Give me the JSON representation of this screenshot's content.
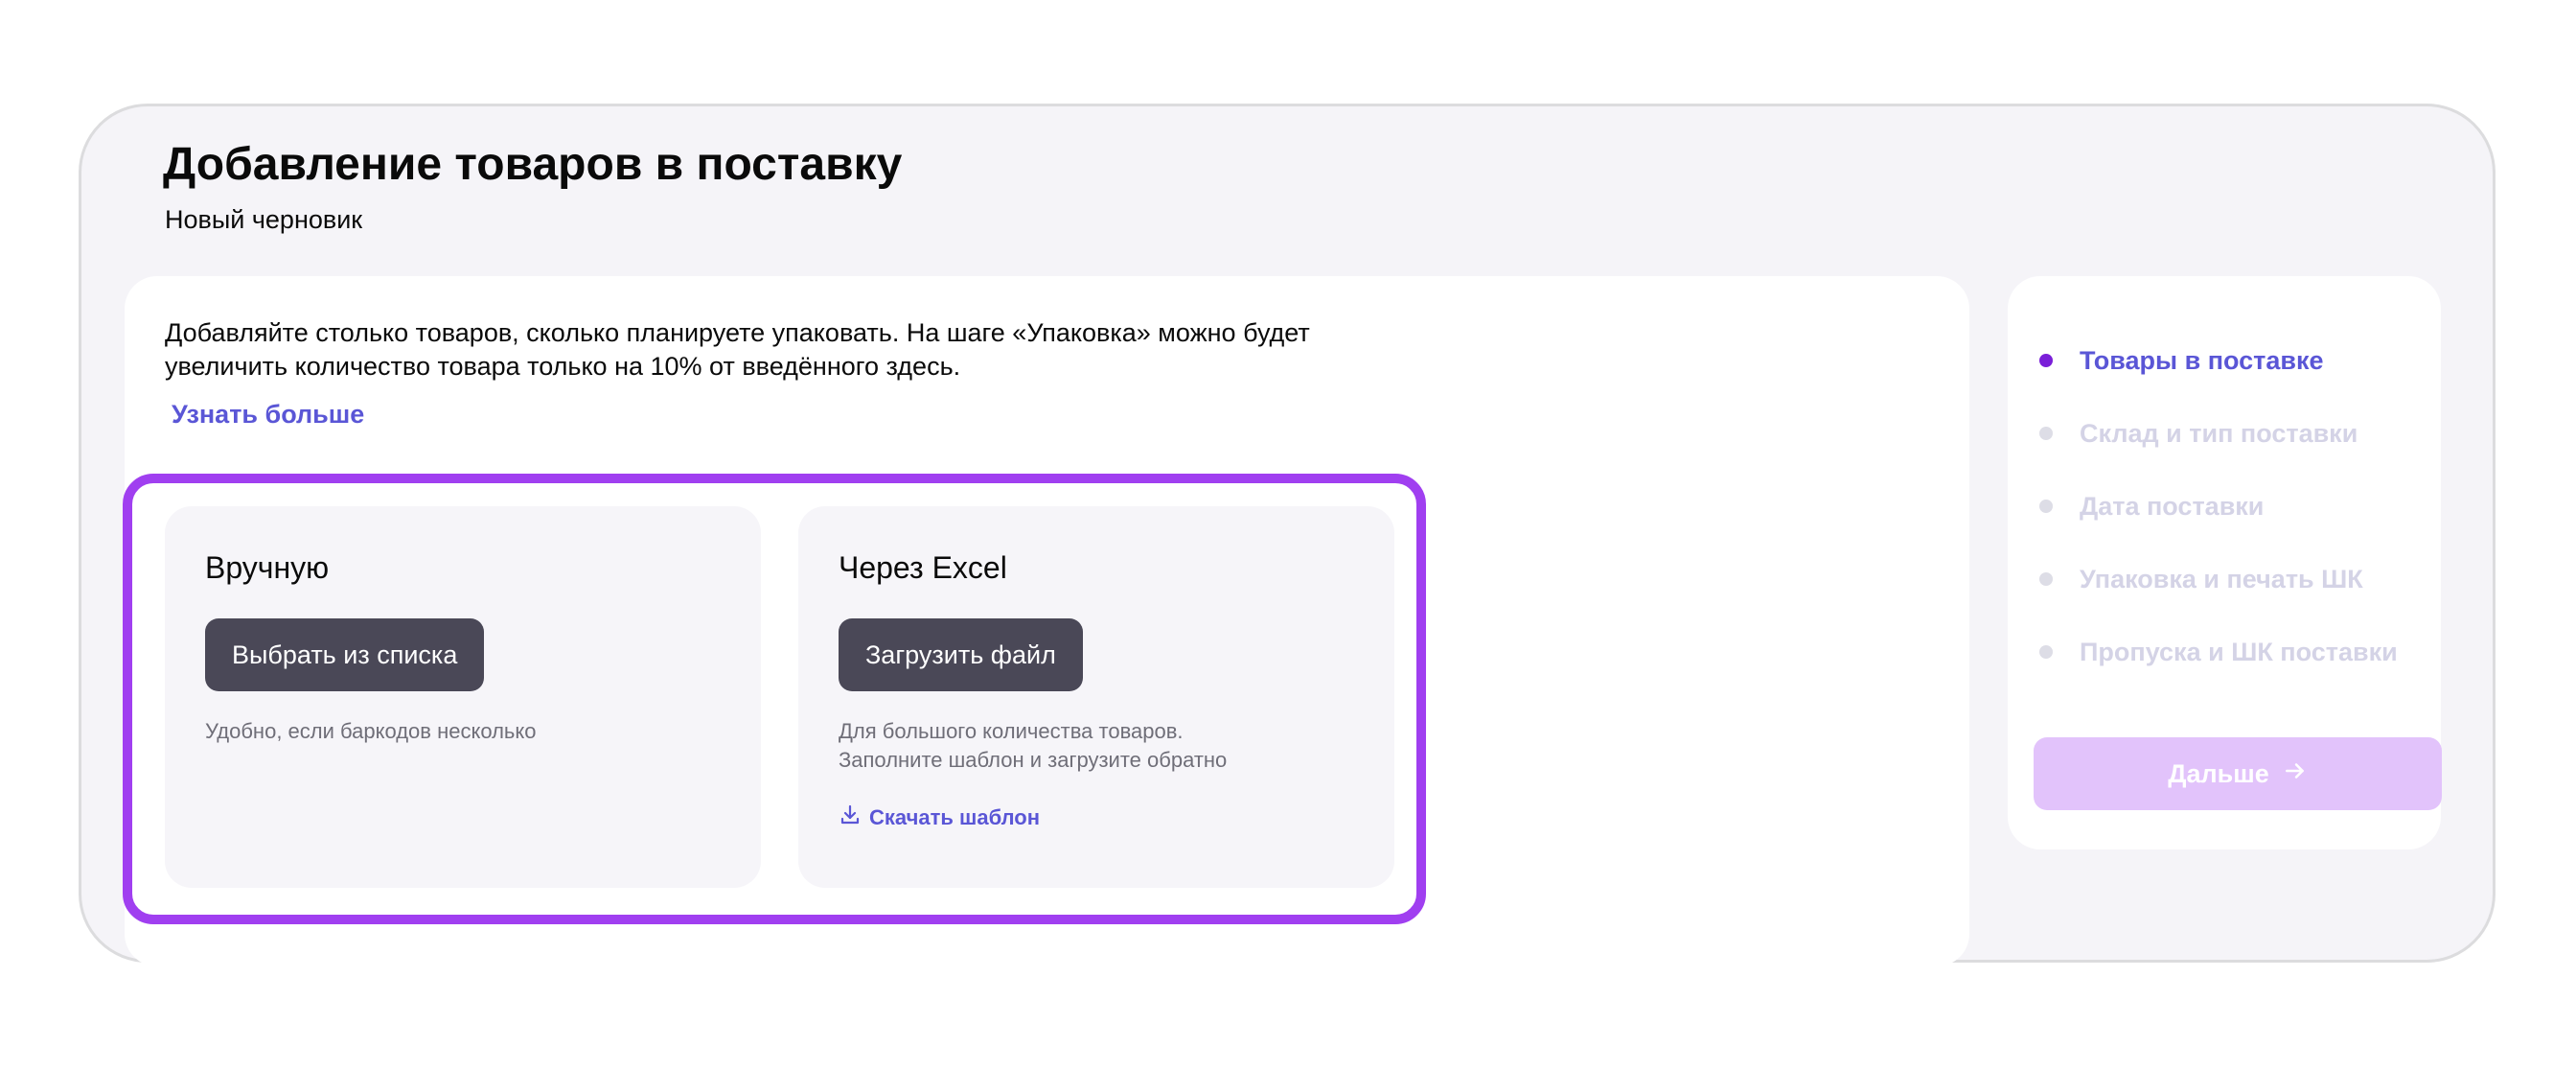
{
  "page": {
    "title": "Добавление товаров в поставку",
    "subtitle": "Новый черновик"
  },
  "info": {
    "text": "Добавляйте столько товаров, сколько планируете упаковать. На шаге «Упаковка» можно будет увеличить количество товара только на 10% от введённого здесь.",
    "learn_more": "Узнать больше"
  },
  "options": {
    "manual": {
      "title": "Вручную",
      "button": "Выбрать из списка",
      "hint": "Удобно, если баркодов несколько"
    },
    "excel": {
      "title": "Через Excel",
      "button": "Загрузить файл",
      "hint_line1": "Для большого количества товаров.",
      "hint_line2": "Заполните шаблон и загрузите обратно",
      "download": "Скачать шаблон",
      "download_icon": "download-icon"
    }
  },
  "steps": [
    {
      "label": "Товары в поставке",
      "active": true
    },
    {
      "label": "Склад и тип поставки",
      "active": false
    },
    {
      "label": "Дата поставки",
      "active": false
    },
    {
      "label": "Упаковка и печать ШК",
      "active": false
    },
    {
      "label": "Пропуска и ШК поставки",
      "active": false
    }
  ],
  "next_button": {
    "label": "Дальше",
    "icon": "arrow-right-icon"
  },
  "colors": {
    "accent": "#5a56d6",
    "highlight": "#a03ff0",
    "active_dot": "#7a1fd8",
    "dark_button": "#4a4857",
    "next_button_disabled": "#e2c3fb"
  }
}
